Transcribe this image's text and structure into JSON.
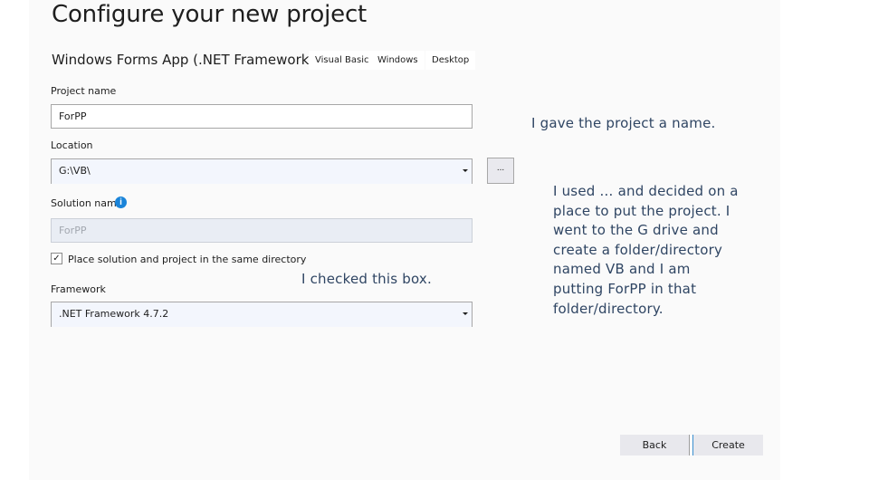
{
  "dialog": {
    "title": "Configure your new project",
    "template_name": "Windows Forms App (.NET Framework)",
    "tags": [
      "Visual Basic",
      "Windows",
      "Desktop"
    ]
  },
  "form": {
    "project_name": {
      "label": "Project name",
      "value": "ForPP"
    },
    "location": {
      "label": "Location",
      "value": "G:\\VB\\",
      "browse_label": "..."
    },
    "solution_name": {
      "label": "Solution name",
      "value": "ForPP",
      "info_icon": "info-icon"
    },
    "same_directory": {
      "label": "Place solution and project in the same directory",
      "checked": true,
      "check_glyph": "✓"
    },
    "framework": {
      "label": "Framework",
      "value": ".NET Framework 4.7.2"
    }
  },
  "buttons": {
    "back": "Back",
    "create": "Create"
  },
  "annotations": {
    "name_note": "I gave the project a name.",
    "checkbox_note": "I checked this box.",
    "location_note": "I used … and decided on a place to put the project. I went to the G drive and create a folder/directory named VB and I am putting ForPP in that folder/directory."
  },
  "colors": {
    "annotation_text": "#2f4563",
    "info_blue": "#1a84d9",
    "accent": "#3a8fd1"
  }
}
